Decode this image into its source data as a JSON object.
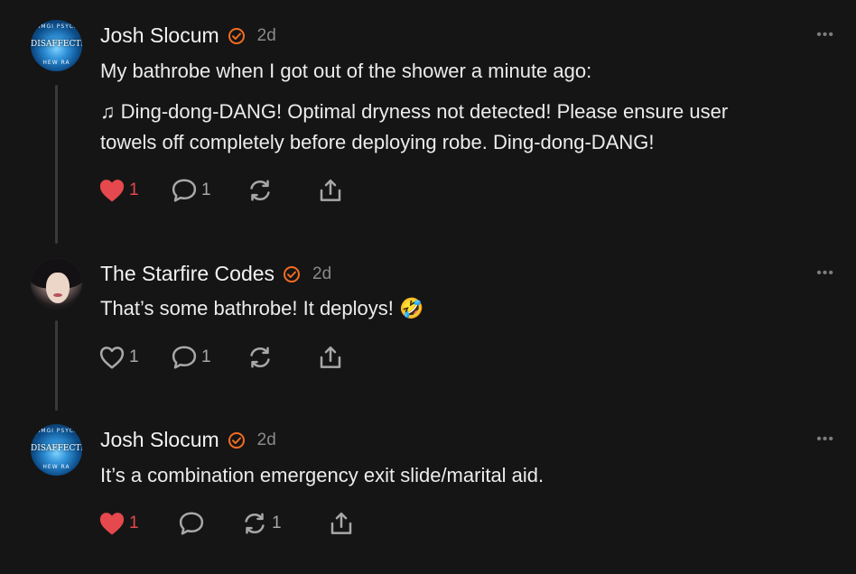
{
  "posts": [
    {
      "author": "Josh Slocum",
      "time": "2d",
      "more": "•••",
      "avatar": {
        "top_text": "SIMGI PSYCH",
        "mid_text": "DISAFFECTED",
        "bottom_text": "HEW RA"
      },
      "text_lines": [
        "My bathrobe when I got out of the shower a minute ago:",
        "♫ Ding-dong-DANG! Optimal dryness not detected! Please ensure user",
        "towels off completely before deploying robe. Ding-dong-DANG!"
      ],
      "likes": "1",
      "liked": true,
      "replies": "1",
      "reposts": ""
    },
    {
      "author": "The Starfire Codes",
      "time": "2d",
      "more": "•••",
      "text_lines": [
        "That’s some bathrobe! It deploys! 🤣"
      ],
      "likes": "1",
      "liked": false,
      "replies": "1",
      "reposts": ""
    },
    {
      "author": "Josh Slocum",
      "time": "2d",
      "more": "•••",
      "avatar": {
        "top_text": "SIMGI PSYCH",
        "mid_text": "DISAFFECTED",
        "bottom_text": "HEW RA"
      },
      "text_lines": [
        "It’s a combination emergency exit slide/marital aid."
      ],
      "likes": "1",
      "liked": true,
      "replies": "",
      "reposts": "1"
    }
  ],
  "colors": {
    "verified": "#f26d21",
    "like_active": "#e5484d",
    "icon": "#a8a8a8",
    "thread_line": "#3a3a3a"
  },
  "icons": {
    "verified": "verified-check-icon",
    "like": "heart-icon",
    "reply": "comment-icon",
    "repost": "repost-icon",
    "share": "share-icon"
  }
}
